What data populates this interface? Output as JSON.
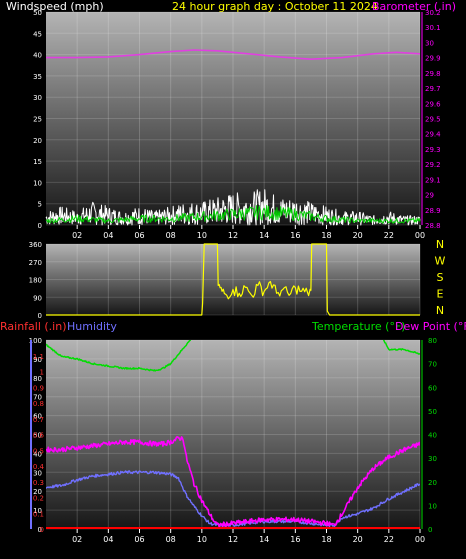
{
  "header": {
    "left_label": "Windspeed (mph)",
    "center_label": "24 hour graph day : October 11 2024",
    "right_label": "Barometer (.in)"
  },
  "colors": {
    "windspeed": "#ffffff",
    "gust": "#ffffff",
    "avg_wind": "#00cc00",
    "barometer": "#e040e0",
    "direction": "#ffff00",
    "rain": "#ff0000",
    "humidity": "#7070ff",
    "temperature": "#00dd00",
    "dewpoint": "#ff00ff",
    "panel_top": "#a0a0a0",
    "panel_bottom": "#202020"
  },
  "chart_data": [
    {
      "type": "line",
      "title": "24 hour graph day : October 11 2024",
      "ylabel_left": "Windspeed (mph)",
      "ylabel_right": "Barometer (.in)",
      "x_ticks": [
        "02",
        "04",
        "06",
        "08",
        "10",
        "12",
        "14",
        "16",
        "18",
        "20",
        "22",
        "00"
      ],
      "x_range": [
        0,
        24
      ],
      "ylim_left": [
        0,
        50
      ],
      "ylim_right": [
        28.8,
        30.2
      ],
      "y_ticks_left": [
        "0",
        "5",
        "10",
        "15",
        "20",
        "25",
        "30",
        "35",
        "40",
        "45",
        "50"
      ],
      "y_ticks_right": [
        "28.8",
        "28.9",
        "29",
        "29.1",
        "29.2",
        "29.3",
        "29.4",
        "29.5",
        "29.6",
        "29.7",
        "29.8",
        "29.9",
        "30",
        "30.1",
        "30.2"
      ],
      "grid": true,
      "series": [
        {
          "name": "Barometer",
          "axis": "right",
          "x": [
            0,
            2,
            4,
            6,
            8,
            9.5,
            11,
            13,
            15,
            17,
            19,
            21,
            22.5,
            24
          ],
          "y": [
            29.9,
            29.9,
            29.905,
            29.92,
            29.94,
            29.95,
            29.945,
            29.925,
            29.905,
            29.89,
            29.9,
            29.925,
            29.935,
            29.925
          ]
        },
        {
          "name": "Windspeed",
          "axis": "left",
          "x": [
            0,
            1,
            2,
            3,
            4,
            5,
            6,
            7,
            8,
            9,
            10,
            11,
            12,
            13,
            14,
            15,
            16,
            17,
            18,
            19,
            20,
            21,
            22,
            23,
            24
          ],
          "y": [
            3,
            4,
            3,
            5,
            4,
            3,
            4,
            3,
            4,
            5,
            5,
            6,
            7,
            7,
            8,
            6,
            6,
            5,
            4,
            3,
            3,
            2,
            3,
            2,
            2
          ]
        },
        {
          "name": "Average wind",
          "axis": "left",
          "x": [
            0,
            2,
            4,
            6,
            8,
            10,
            12,
            14,
            16,
            18,
            20,
            22,
            24
          ],
          "y": [
            1,
            1.5,
            1,
            1.5,
            1.5,
            2,
            2.5,
            3,
            2.5,
            1.5,
            1,
            1,
            1
          ]
        }
      ]
    },
    {
      "type": "scatter",
      "title": "",
      "ylabel": "",
      "x_ticks": [],
      "x_range": [
        0,
        24
      ],
      "ylim": [
        0,
        360
      ],
      "y_ticks": [
        "0",
        "90",
        "180",
        "270",
        "360"
      ],
      "compass_labels": [
        "N",
        "W",
        "S",
        "E",
        "N"
      ],
      "series": [
        {
          "name": "Wind direction",
          "x": [
            0,
            10,
            10.05,
            10.15,
            10.3,
            10.6,
            10.9,
            11.0,
            11.05,
            11.3,
            11.6,
            12,
            12.4,
            12.8,
            13.2,
            13.6,
            14,
            14.4,
            14.8,
            15.2,
            15.6,
            16,
            16.4,
            16.8,
            17,
            17.05,
            17.2,
            17.6,
            18.0,
            18.05,
            18.2,
            24
          ],
          "y": [
            0,
            0,
            60,
            360,
            360,
            360,
            360,
            360,
            150,
            120,
            100,
            130,
            110,
            140,
            100,
            150,
            120,
            170,
            110,
            130,
            100,
            140,
            120,
            110,
            125,
            360,
            360,
            360,
            360,
            20,
            0,
            0
          ]
        }
      ]
    },
    {
      "type": "line",
      "title": "",
      "ylabel_left": "Rainfall (.in)",
      "ylabel_left2": "Humidity",
      "ylabel_right": "Temperature (°F)",
      "ylabel_right2": "Dew Point (°F)",
      "x_ticks": [
        "02",
        "04",
        "06",
        "08",
        "10",
        "12",
        "14",
        "16",
        "18",
        "20",
        "22",
        "00"
      ],
      "x_range": [
        0,
        24
      ],
      "ylim_humidity": [
        0,
        100
      ],
      "ylim_rain": [
        0,
        1.2
      ],
      "ylim_temperature": [
        0,
        80
      ],
      "y_ticks_humidity": [
        "0",
        "10",
        "20",
        "30",
        "40",
        "50",
        "60",
        "70",
        "80",
        "90",
        "100"
      ],
      "y_ticks_rain": [
        "0",
        "0.1",
        "0.2",
        "0.3",
        "0.4",
        "0.5",
        "0.6",
        "0.7",
        "0.8",
        "0.9",
        "1",
        "1.1"
      ],
      "y_ticks_temperature": [
        "0",
        "10",
        "20",
        "30",
        "40",
        "50",
        "60",
        "70",
        "80"
      ],
      "grid": true,
      "series": [
        {
          "name": "Temperature",
          "axis": "temperature",
          "x": [
            0,
            1,
            2,
            3,
            4,
            5,
            6,
            7,
            7.5,
            8,
            8.5,
            9,
            9.5
          ],
          "y": [
            78,
            73,
            72,
            70,
            69,
            68,
            68,
            67,
            68,
            70,
            74,
            78,
            82
          ]
        },
        {
          "name": "Temperature",
          "axis": "temperature",
          "x": [
            21.5,
            22,
            23,
            24
          ],
          "y": [
            82,
            76,
            76,
            74
          ]
        },
        {
          "name": "Humidity",
          "axis": "humidity",
          "x": [
            0,
            1,
            2,
            3,
            4,
            5,
            6,
            7,
            8,
            8.5,
            9,
            9.5,
            10,
            10.5,
            11,
            12,
            13,
            14,
            15,
            16,
            17,
            18,
            18.5,
            19,
            20,
            21,
            22,
            23,
            24
          ],
          "y": [
            22,
            23,
            26,
            28,
            29,
            30,
            30,
            30,
            29,
            27,
            18,
            12,
            7,
            3,
            2,
            2,
            3,
            4,
            4,
            4,
            3,
            2,
            2,
            6,
            8,
            11,
            16,
            20,
            24
          ]
        },
        {
          "name": "Dew Point",
          "axis": "humidity",
          "x": [
            0,
            1,
            2,
            3,
            4,
            5,
            6,
            7,
            7.5,
            8,
            8.5,
            8.8,
            9,
            9.5,
            10,
            10.5,
            10.8,
            11,
            12,
            13,
            14,
            15,
            16,
            17,
            18,
            18.5,
            19,
            20,
            21,
            22,
            23,
            24
          ],
          "y": [
            42,
            42,
            43,
            44,
            45,
            46,
            46,
            45,
            45,
            46,
            48,
            48,
            38,
            24,
            15,
            8,
            4,
            2,
            3,
            4,
            5,
            5,
            5,
            4,
            3,
            2,
            8,
            22,
            32,
            38,
            42,
            45
          ]
        },
        {
          "name": "Rainfall",
          "axis": "rain",
          "x": [
            0,
            24
          ],
          "y": [
            0,
            0
          ]
        }
      ]
    }
  ]
}
